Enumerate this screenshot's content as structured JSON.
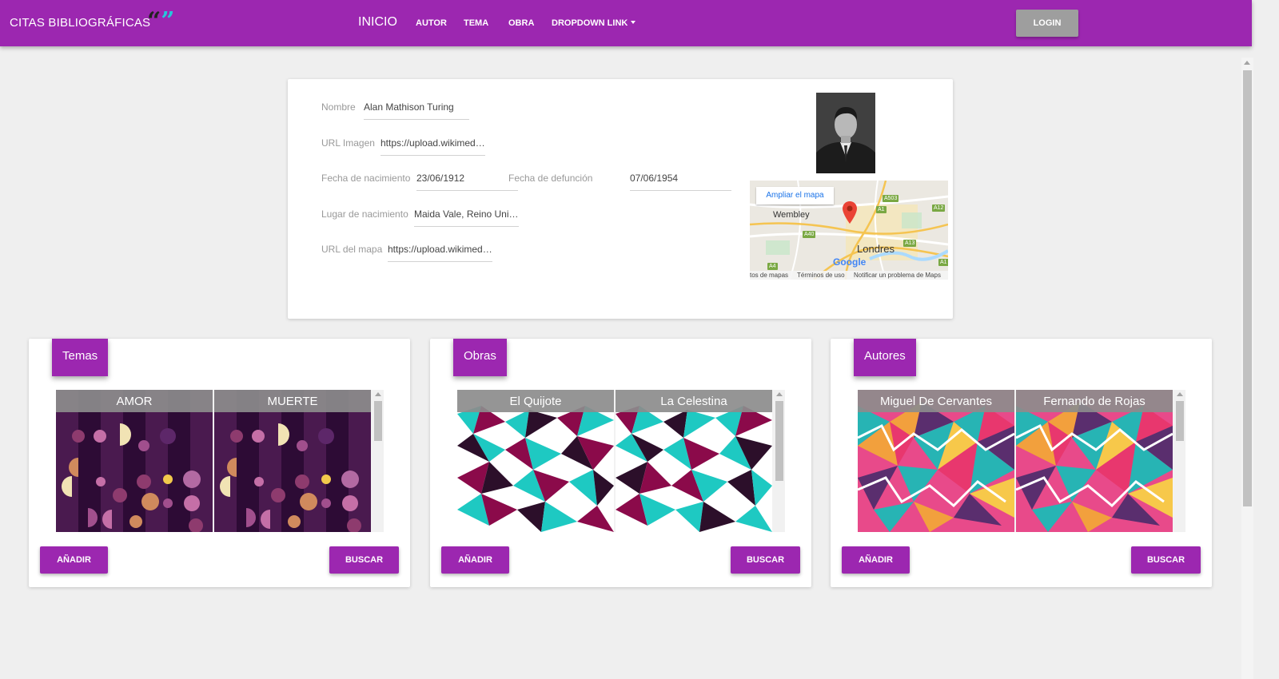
{
  "navbar": {
    "brand": "CITAS BIBLIOGRÁFICAS",
    "brand_quotes": {
      "open": "“",
      "close": "”"
    },
    "inicio": "INICIO",
    "links": [
      "AUTOR",
      "TEMA",
      "OBRA"
    ],
    "dropdown": "DROPDOWN LINK",
    "login": "LOGIN"
  },
  "author": {
    "fields": {
      "nombre": {
        "label": "Nombre",
        "value": "Alan Mathison Turing"
      },
      "url_imagen": {
        "label": "URL Imagen",
        "value": "https://upload.wikimedi..."
      },
      "fecha_nacimiento": {
        "label": "Fecha de nacimiento",
        "value": "23/06/1912"
      },
      "fecha_defuncion": {
        "label": "Fecha de defunción",
        "value": "07/06/1954"
      },
      "lugar_nacimiento": {
        "label": "Lugar de nacimiento",
        "value": "Maida Vale, Reino Unid..."
      },
      "url_mapa": {
        "label": "URL del mapa",
        "value": "https://upload.wikimedi..."
      }
    },
    "map": {
      "expand_label": "Ampliar el mapa",
      "places": {
        "wembley": "Wembley",
        "londres": "Londres"
      },
      "logo": "Google",
      "roads": [
        "A503",
        "A1",
        "A12",
        "A40",
        "A13",
        "A4",
        "A1"
      ],
      "footer": {
        "data": "tos de mapas",
        "terms": "Términos de uso",
        "report": "Notificar un problema de Maps"
      }
    }
  },
  "panels": {
    "temas": {
      "title": "Temas",
      "items": [
        "AMOR",
        "MUERTE"
      ],
      "add": "AÑADIR",
      "search": "BUSCAR"
    },
    "obras": {
      "title": "Obras",
      "items": [
        "El Quijote",
        "La Celestina"
      ],
      "add": "AÑADIR",
      "search": "BUSCAR"
    },
    "autores": {
      "title": "Autores",
      "items": [
        "Miguel De Cervantes",
        "Fernando de Rojas"
      ],
      "add": "AÑADIR",
      "search": "BUSCAR"
    }
  },
  "colors": {
    "primary": "#9c27b0",
    "login": "#9e9e9e",
    "background": "#efefef"
  },
  "icons": [
    "quote-icon",
    "caret-down-icon",
    "map-pin-icon"
  ]
}
